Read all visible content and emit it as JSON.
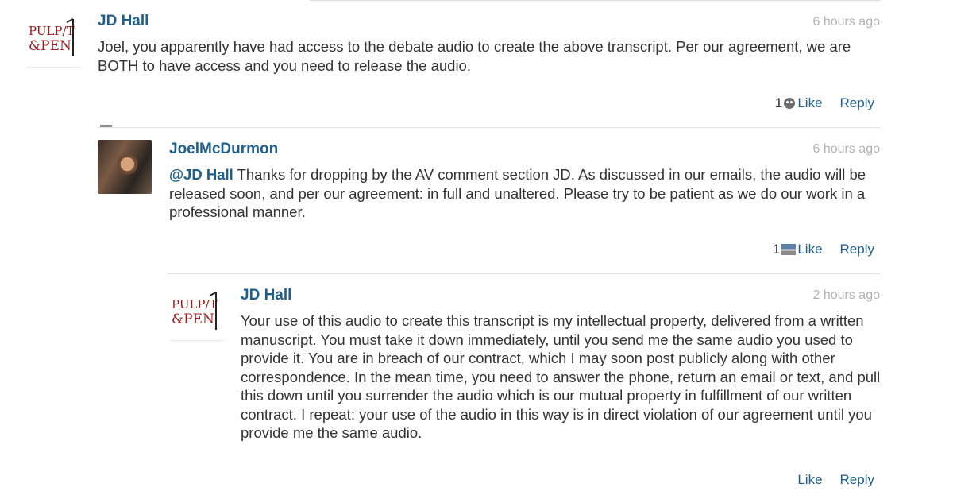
{
  "comments": [
    {
      "author": "JD Hall",
      "timestamp": "6 hours ago",
      "text": "Joel, you apparently have had access to the debate audio to create the above transcript. Per our agreement, we are BOTH to have access and you need to release the audio.",
      "likes": "1",
      "like_label": "Like",
      "reply_label": "Reply",
      "avatar": {
        "logo_line1": "PULP/T",
        "logo_line2": "&PEN"
      }
    },
    {
      "author": "JoelMcDurmon",
      "timestamp": "6 hours ago",
      "mention": "@JD Hall",
      "text": " Thanks for dropping by the AV comment section JD. As discussed in our emails, the audio will be released soon, and per our agreement: in full and unaltered. Please try to be patient as we do our work in a professional manner.",
      "likes": "1",
      "like_label": "Like",
      "reply_label": "Reply"
    },
    {
      "author": "JD Hall",
      "timestamp": "2 hours ago",
      "text": "Your use of this audio to create this transcript is my intellectual property, delivered from a written manuscript. You must take it down immediately, until you send me the same audio you used to provide it. You are in breach of our contract, which I may soon post publicly along with other correspondence. In the mean time, you need to answer the phone, return an email or text, and pull this down until you surrender the audio which is our mutual property in fulfillment of our written contract. I repeat: your use of the audio in this way is in direct violation of our agreement until you provide me the same audio.",
      "like_label": "Like",
      "reply_label": "Reply",
      "avatar": {
        "logo_line1": "PULP/T",
        "logo_line2": "&PEN"
      }
    }
  ],
  "colors": {
    "link": "#1f5f8b",
    "logo_red": "#9e1b1b",
    "timestamp": "#b3b3b3"
  },
  "icons": [
    "smiley-face-icon",
    "photo-thumbnail-icon",
    "collapse-icon"
  ]
}
